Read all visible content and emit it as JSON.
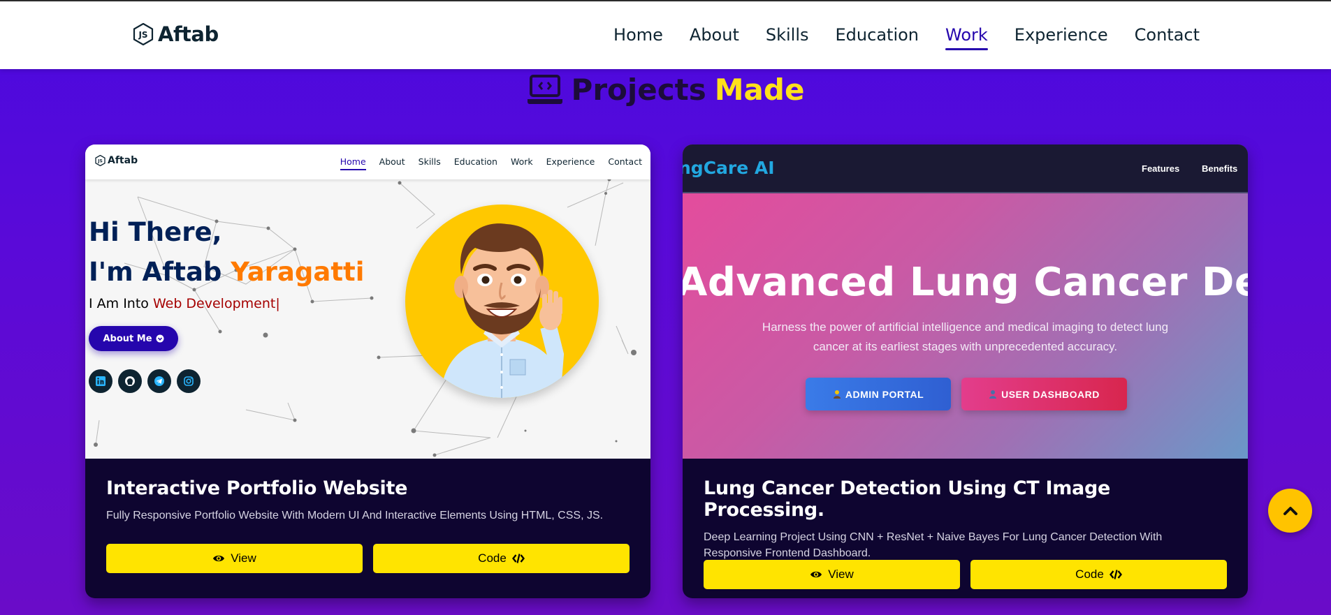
{
  "nav": {
    "brand": "Aftab",
    "links": [
      "Home",
      "About",
      "Skills",
      "Education",
      "Work",
      "Experience",
      "Contact"
    ],
    "active": "Work"
  },
  "section": {
    "title_part1": "Projects",
    "title_part2": "Made"
  },
  "projects": [
    {
      "title": "Interactive Portfolio Website",
      "description": "Fully Responsive Portfolio Website With Modern UI And Interactive Elements Using HTML, CSS, JS.",
      "view_label": "View",
      "code_label": "Code",
      "preview": {
        "brand": "Aftab",
        "links": [
          "Home",
          "About",
          "Skills",
          "Education",
          "Work",
          "Experience",
          "Contact"
        ],
        "greeting": "Hi There,",
        "name_prefix": "I'm Aftab ",
        "name_highlight": "Yaragatti",
        "into_prefix": "I Am Into ",
        "into_highlight": "Web Development|",
        "about_btn": "About Me"
      }
    },
    {
      "title": "Lung Cancer Detection Using CT Image Processing.",
      "description": "Deep Learning Project Using CNN + ResNet + Naive Bayes For Lung Cancer Detection With Responsive Frontend Dashboard.",
      "view_label": "View",
      "code_label": "Code",
      "preview": {
        "logo": "ngCare AI",
        "links": [
          "Features",
          "Benefits"
        ],
        "headline": "Advanced Lung Cancer Detectio",
        "subtitle_line1": "Harness the power of artificial intelligence and medical imaging to detect lung",
        "subtitle_line2": "cancer at its earliest stages with unprecedented accuracy.",
        "admin_btn": "ADMIN PORTAL",
        "user_btn": "USER DASHBOARD"
      }
    }
  ],
  "colors": {
    "accent_yellow": "#ffe400",
    "nav_active": "#2506ad",
    "bg_purple": "#4a09df"
  }
}
